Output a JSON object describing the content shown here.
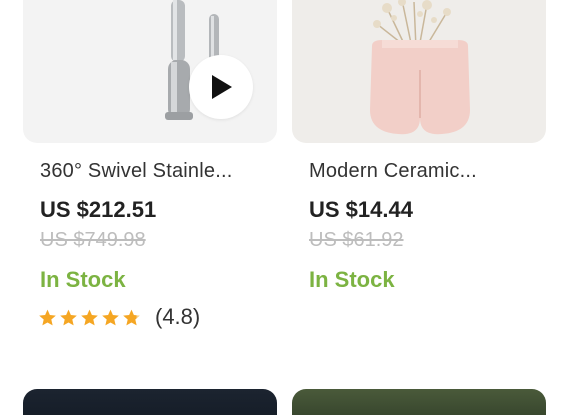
{
  "products": [
    {
      "title": "360° Swivel Stainle...",
      "price": "US $212.51",
      "original_price": "US $749.98",
      "stock": "In Stock",
      "rating": "(4.8)",
      "stars": 4.8,
      "has_video": true,
      "image": "faucet-image"
    },
    {
      "title": "Modern Ceramic...",
      "price": "US $14.44",
      "original_price": "US $61.92",
      "stock": "In Stock",
      "image": "vase-image"
    }
  ],
  "colors": {
    "in_stock": "#7cb342",
    "star": "#f5a623",
    "strikethrough": "#bdbdbd"
  }
}
